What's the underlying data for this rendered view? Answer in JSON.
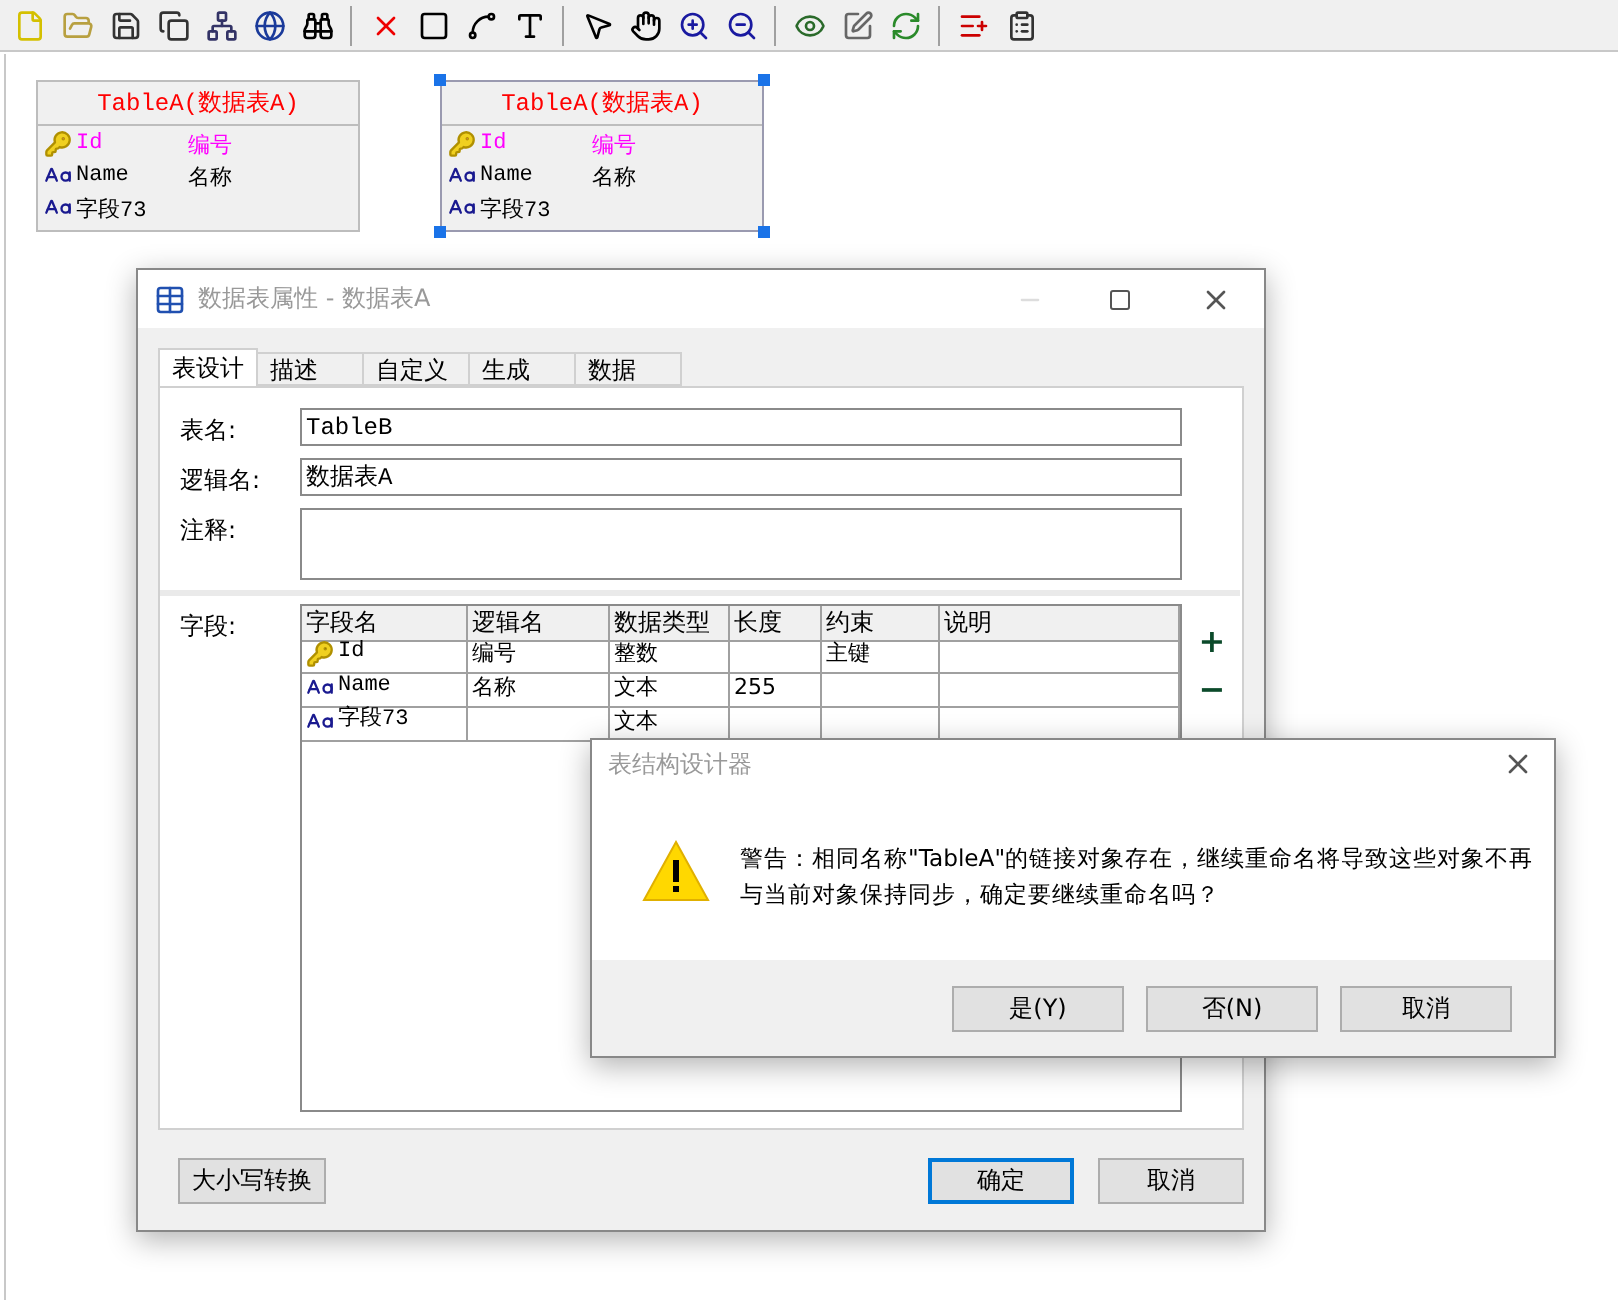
{
  "canvas": {
    "entities": [
      {
        "title": "TableA(数据表A)",
        "selected": false,
        "fields": [
          {
            "kind": "key",
            "name": "Id",
            "logical": "编号"
          },
          {
            "kind": "text",
            "name": "Name",
            "logical": "名称"
          },
          {
            "kind": "text",
            "name": "字段73"
          }
        ]
      },
      {
        "title": "TableA(数据表A)",
        "selected": true,
        "fields": [
          {
            "kind": "key",
            "name": "Id",
            "logical": "编号"
          },
          {
            "kind": "text",
            "name": "Name",
            "logical": "名称"
          },
          {
            "kind": "text",
            "name": "字段73"
          }
        ]
      }
    ]
  },
  "dialog": {
    "title": "数据表属性 - 数据表A",
    "tabs": [
      {
        "label": "表设计",
        "selected": true
      },
      {
        "label": "描述",
        "selected": false
      },
      {
        "label": "自定义",
        "selected": false
      },
      {
        "label": "生成",
        "selected": false
      },
      {
        "label": "数据",
        "selected": false
      }
    ],
    "table_name_label": "表名:",
    "table_name": "TableB",
    "logical_name_label": "逻辑名:",
    "logical_name": "数据表A",
    "comment_label": "注释:",
    "fields_label": "字段:",
    "grid": {
      "columns": [
        "字段名",
        "逻辑名",
        "数据类型",
        "长度",
        "约束",
        "说明"
      ],
      "rows": [
        {
          "kind": "key",
          "name": "Id",
          "logical": "编号",
          "type": "整数",
          "constraint": "主键"
        },
        {
          "kind": "text",
          "name": "Name",
          "logical": "名称",
          "type": "文本",
          "length": "255"
        },
        {
          "kind": "text",
          "name": "字段73",
          "type": "文本"
        }
      ]
    },
    "add_button": "+",
    "remove_button": "−",
    "buttons": [
      {
        "label": "大小写转换",
        "focused": false
      },
      {
        "label": "确定",
        "focused": true
      },
      {
        "label": "取消",
        "focused": false
      }
    ]
  },
  "message": {
    "title": "表结构设计器",
    "text": "警告：相同名称\"TableA\"的链接对象存在，继续重命名将导致这些对象不再与当前对象保持同步，确定要继续重命名吗？",
    "buttons": [
      {
        "label": "是(Y)"
      },
      {
        "label": "否(N)"
      },
      {
        "label": "取消"
      }
    ]
  }
}
